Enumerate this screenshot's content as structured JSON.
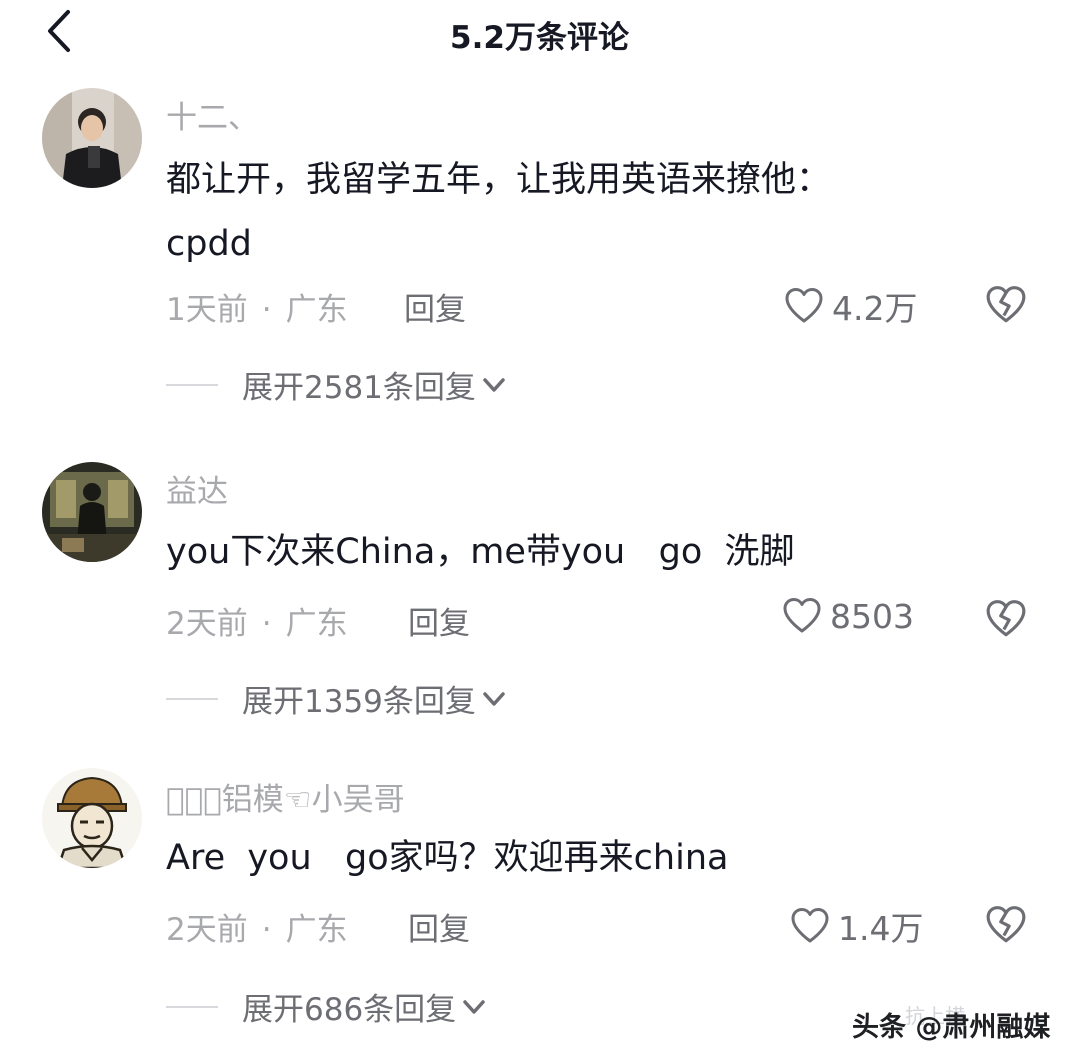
{
  "header": {
    "title": "5.2万条评论"
  },
  "comments": [
    {
      "username": "十二、",
      "text": "都让开，我留学五年，让我用英语来撩他：\ncpdd",
      "time": "1天前",
      "location": "广东",
      "reply_label": "回复",
      "likes": "4.2万",
      "expand_label": "展开2581条回复"
    },
    {
      "username": "益达",
      "text": "you下次来China，me带you   go  洗脚",
      "time": "2天前",
      "location": "广东",
      "reply_label": "回复",
      "likes": "8503",
      "expand_label": "展开1359条回复"
    },
    {
      "username": "􀀀􀀀􀀀铝模☜小吴哥",
      "text": "Are  you   go家吗？欢迎再来china",
      "time": "2天前",
      "location": "广东",
      "reply_label": "回复",
      "likes": "1.4万",
      "expand_label": "展开686条回复"
    }
  ],
  "watermark": {
    "text": "头条 @肃州融媒",
    "faint_text": "抗上横"
  },
  "icons": {
    "back": "chevron-left-icon",
    "like": "heart-outline-icon",
    "dislike": "broken-heart-icon",
    "expand": "chevron-down-icon"
  }
}
